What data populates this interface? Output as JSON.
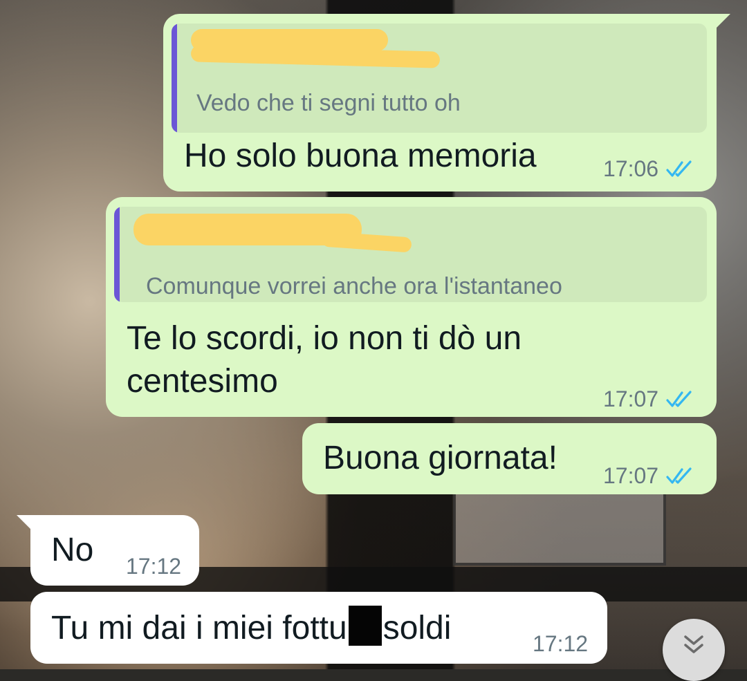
{
  "messages": [
    {
      "id": "m1",
      "direction": "outgoing",
      "quote_text": "Vedo che ti segni tutto oh",
      "quote_sender_redacted": true,
      "text": "Ho solo buona memoria",
      "time": "17:06",
      "status": "read"
    },
    {
      "id": "m2",
      "direction": "outgoing",
      "quote_text": "Comunque vorrei anche ora l'istantaneo",
      "quote_sender_redacted": true,
      "text_line1": "Te lo scordi, io non ti dò un",
      "text_line2": "centesimo",
      "time": "17:07",
      "status": "read"
    },
    {
      "id": "m3",
      "direction": "outgoing",
      "text": "Buona giornata!",
      "time": "17:07",
      "status": "read"
    },
    {
      "id": "m4",
      "direction": "incoming",
      "text": "No",
      "time": "17:12"
    },
    {
      "id": "m5",
      "direction": "incoming",
      "text_before": "Tu mi dai i miei fottu",
      "text_after": "soldi",
      "redacted": true,
      "time": "17:12"
    }
  ],
  "colors": {
    "outgoing_bubble": "#dcf8c6",
    "incoming_bubble": "#ffffff",
    "quote_bar": "#6b56d6",
    "read_ticks": "#34b7f1",
    "redaction_highlight": "#fbd464"
  },
  "icons": {
    "read_status": "double-check-icon",
    "scroll_down": "chevrons-down-icon"
  }
}
